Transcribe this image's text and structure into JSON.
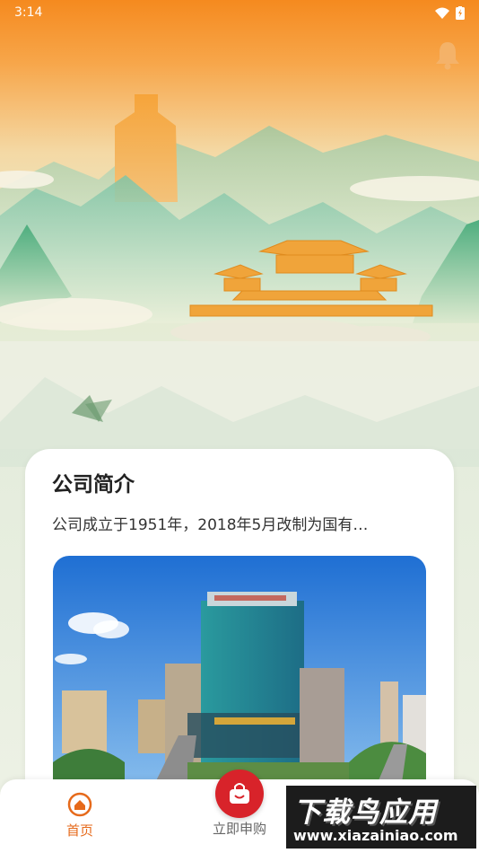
{
  "status_bar": {
    "time": "3:14"
  },
  "card": {
    "title": "公司简介",
    "description": "公司成立于1951年，2018年5月改制为国有…"
  },
  "tab_bar": {
    "tabs": [
      {
        "label": "首页",
        "icon": "home-icon",
        "active": true
      },
      {
        "label": "立即申购",
        "icon": "shopping-bag-icon",
        "active": false
      }
    ]
  },
  "watermark": {
    "title": "下载鸟应用",
    "url": "www.xiazainiao.com"
  },
  "colors": {
    "accent": "#e66a1b",
    "fab": "#d8232a",
    "header_top": "#f58a1f"
  }
}
